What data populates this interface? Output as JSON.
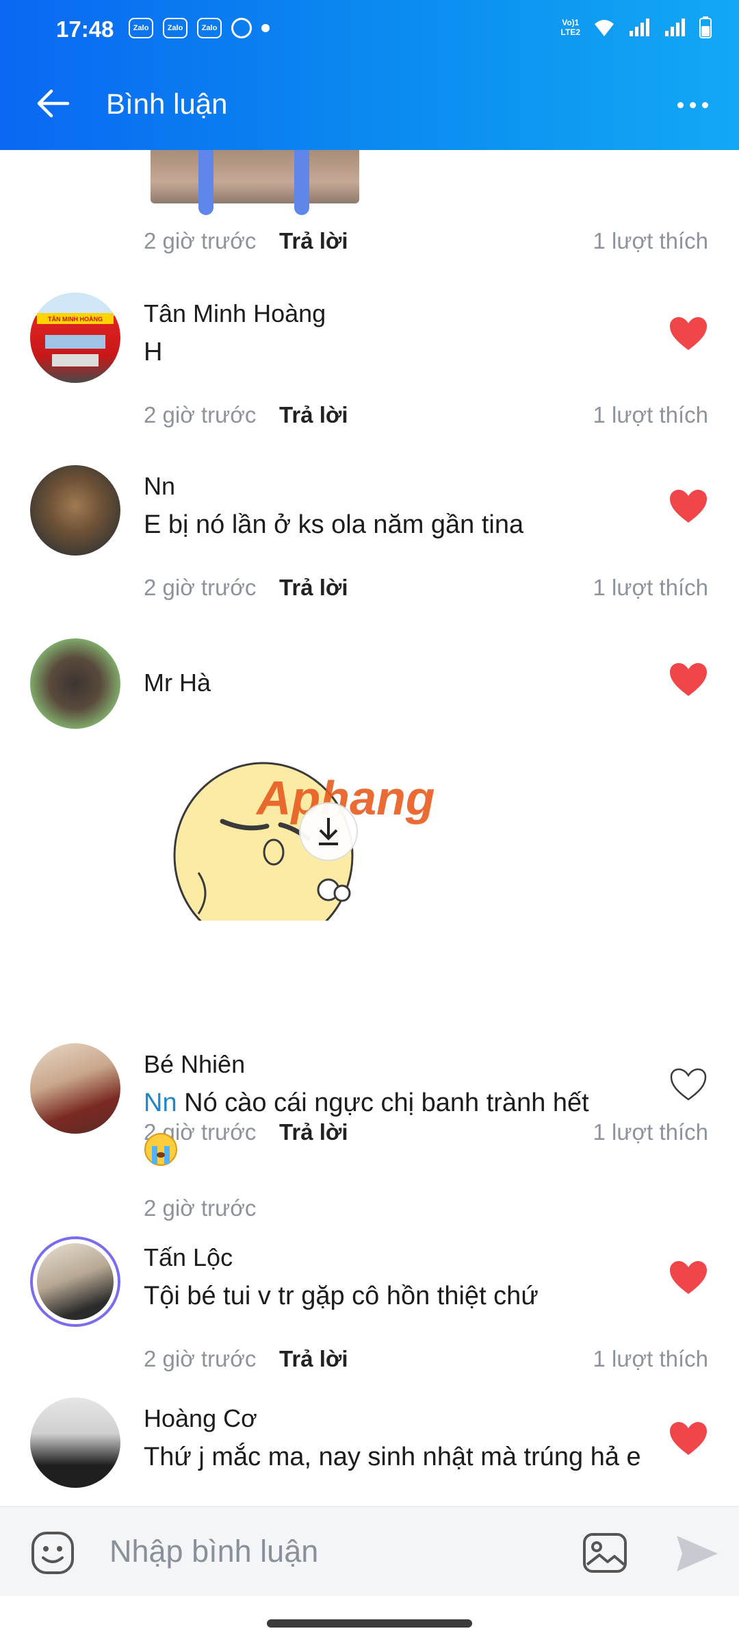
{
  "status": {
    "time": "17:48",
    "apps": [
      "Zalo",
      "Zalo",
      "Zalo"
    ],
    "network": "VoLTE2 LTE2"
  },
  "header": {
    "title": "Bình luận"
  },
  "first_meta": {
    "time": "2 giờ trước",
    "reply": "Trả lời",
    "likes": "1 lượt thích"
  },
  "comments": [
    {
      "author": "Tân Minh Hoàng",
      "text": "H",
      "time": "2 giờ trước",
      "reply": "Trả lời",
      "likes": "1 lượt thích",
      "liked": true,
      "avatar_text": "TÂN MINH HOÀNG"
    },
    {
      "author": "Nn",
      "text": "E bị nó lần ở ks ola năm gần tina",
      "time": "2 giờ trước",
      "reply": "Trả lời",
      "likes": "1 lượt thích",
      "liked": true
    },
    {
      "author": "Mr Hà",
      "text": "",
      "time": "2 giờ trước",
      "reply": "Trả lời",
      "likes": "1 lượt thích",
      "liked": true,
      "sticker_watermark": "Aphang"
    },
    {
      "author": "Bé Nhiên",
      "mention": "Nn",
      "text": "Nó cào cái ngực chị banh trành hết",
      "time": "2 giờ trước",
      "liked": false
    },
    {
      "author": "Tấn Lộc",
      "text": "Tội bé tui v tr gặp cô hồn thiệt chứ",
      "time": "2 giờ trước",
      "reply": "Trả lời",
      "likes": "1 lượt thích",
      "liked": true
    },
    {
      "author": "Hoàng Cơ",
      "text": "Thứ j mắc ma, nay sinh nhật mà trúng hả e",
      "liked": true
    }
  ],
  "input": {
    "placeholder": "Nhập bình luận"
  },
  "colors": {
    "header_start": "#0a68f2",
    "header_end": "#12a8f5",
    "heart": "#f0464a",
    "mention": "#1f86c9"
  }
}
